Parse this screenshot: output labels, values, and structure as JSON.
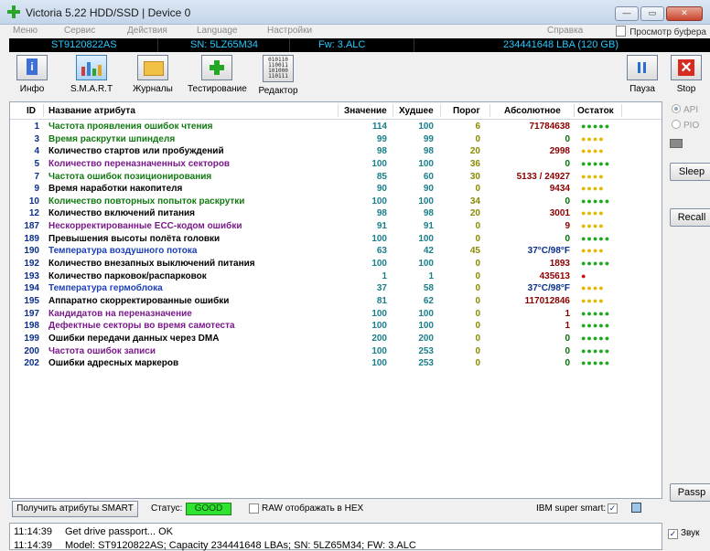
{
  "window": {
    "title": "Victoria 5.22 HDD/SSD | Device 0"
  },
  "menu": {
    "items": [
      "Меню",
      "Сервис",
      "Действия",
      "Language",
      "Настройки",
      "Справка"
    ],
    "right": "Просмотр буфера"
  },
  "drive": {
    "model": "ST9120822AS",
    "serial": "SN: 5LZ65M34",
    "firmware": "Fw: 3.ALC",
    "capacity": "234441648 LBA (120 GB)"
  },
  "toolbar": {
    "info": "Инфо",
    "smart": "S.M.A.R.T",
    "logs": "Журналы",
    "test": "Тестирование",
    "editor": "Редактор",
    "pause": "Пауза",
    "stop": "Stop",
    "hex": [
      "010110",
      "110011",
      "101000",
      "110111"
    ]
  },
  "table": {
    "headers": {
      "id": "ID",
      "name": "Название атрибута",
      "value": "Значение",
      "worst": "Худшее",
      "threshold": "Порог",
      "raw": "Абсолютное",
      "remain": "Остаток"
    },
    "rows": [
      {
        "id": "1",
        "name": "Частота проявления ошибок чтения",
        "value": "114",
        "worst": "100",
        "thr": "6",
        "raw": "71784638",
        "dots": "●●●●●"
      },
      {
        "id": "3",
        "name": "Время раскрутки шпинделя",
        "value": "99",
        "worst": "99",
        "thr": "0",
        "raw": "0",
        "dots": "●●●●"
      },
      {
        "id": "4",
        "name": "Количество стартов или пробуждений",
        "value": "98",
        "worst": "98",
        "thr": "20",
        "raw": "2998",
        "dots": "●●●●"
      },
      {
        "id": "5",
        "name": "Количество переназначенных секторов",
        "value": "100",
        "worst": "100",
        "thr": "36",
        "raw": "0",
        "dots": "●●●●●"
      },
      {
        "id": "7",
        "name": "Частота ошибок позиционирования",
        "value": "85",
        "worst": "60",
        "thr": "30",
        "raw": "5133 / 24927",
        "dots": "●●●●"
      },
      {
        "id": "9",
        "name": "Время наработки накопителя",
        "value": "90",
        "worst": "90",
        "thr": "0",
        "raw": "9434",
        "dots": "●●●●"
      },
      {
        "id": "10",
        "name": "Количество повторных попыток раскрутки",
        "value": "100",
        "worst": "100",
        "thr": "34",
        "raw": "0",
        "dots": "●●●●●"
      },
      {
        "id": "12",
        "name": "Количество включений питания",
        "value": "98",
        "worst": "98",
        "thr": "20",
        "raw": "3001",
        "dots": "●●●●"
      },
      {
        "id": "187",
        "name": "Нескорректированные ECC-кодом ошибки",
        "value": "91",
        "worst": "91",
        "thr": "0",
        "raw": "9",
        "dots": "●●●●"
      },
      {
        "id": "189",
        "name": "Превышения высоты полёта головки",
        "value": "100",
        "worst": "100",
        "thr": "0",
        "raw": "0",
        "dots": "●●●●●"
      },
      {
        "id": "190",
        "name": "Температура воздушного потока",
        "value": "63",
        "worst": "42",
        "thr": "45",
        "raw": "37°C/98°F",
        "dots": "●●●●"
      },
      {
        "id": "192",
        "name": "Количество внезапных выключений питания",
        "value": "100",
        "worst": "100",
        "thr": "0",
        "raw": "1893",
        "dots": "●●●●●"
      },
      {
        "id": "193",
        "name": "Количество парковок/распарковок",
        "value": "1",
        "worst": "1",
        "thr": "0",
        "raw": "435613",
        "dots": "●"
      },
      {
        "id": "194",
        "name": "Температура гермоблока",
        "value": "37",
        "worst": "58",
        "thr": "0",
        "raw": "37°C/98°F",
        "dots": "●●●●"
      },
      {
        "id": "195",
        "name": "Аппаратно скорректированные ошибки",
        "value": "81",
        "worst": "62",
        "thr": "0",
        "raw": "117012846",
        "dots": "●●●●"
      },
      {
        "id": "197",
        "name": "Кандидатов на переназначение",
        "value": "100",
        "worst": "100",
        "thr": "0",
        "raw": "1",
        "dots": "●●●●●"
      },
      {
        "id": "198",
        "name": "Дефектные секторы во время самотеста",
        "value": "100",
        "worst": "100",
        "thr": "0",
        "raw": "1",
        "dots": "●●●●●"
      },
      {
        "id": "199",
        "name": "Ошибки передачи данных через DMA",
        "value": "200",
        "worst": "200",
        "thr": "0",
        "raw": "0",
        "dots": "●●●●●"
      },
      {
        "id": "200",
        "name": "Частота ошибок записи",
        "value": "100",
        "worst": "253",
        "thr": "0",
        "raw": "0",
        "dots": "●●●●●"
      },
      {
        "id": "202",
        "name": "Ошибки адресных маркеров",
        "value": "100",
        "worst": "253",
        "thr": "0",
        "raw": "0",
        "dots": "●●●●●"
      }
    ]
  },
  "side": {
    "api": "API",
    "pio": "PIO",
    "sleep": "Sleep",
    "recall": "Recall",
    "passp": "Passp"
  },
  "bottom": {
    "get_smart": "Получить атрибуты SMART",
    "status_label": "Статус:",
    "status_value": "GOOD",
    "raw_hex": "RAW отображать в HEX",
    "ibm": "IBM super smart:",
    "ibm_check": "✓"
  },
  "log": {
    "lines": [
      {
        "time": "11:14:39",
        "text": "Get drive passport... OK"
      },
      {
        "time": "11:14:39",
        "text": "Model: ST9120822AS; Capacity 234441648 LBAs; SN: 5LZ65M34; FW: 3.ALC"
      }
    ]
  },
  "sound": {
    "label": "Звук",
    "check": "✓"
  },
  "colors": {
    "info_bg": "#000000",
    "info_text": "#27c9ff",
    "status_good": "#31e331",
    "green_dot": "#1ea81e",
    "yellow_dot": "#e5b800",
    "red_dot": "#d0100d"
  }
}
